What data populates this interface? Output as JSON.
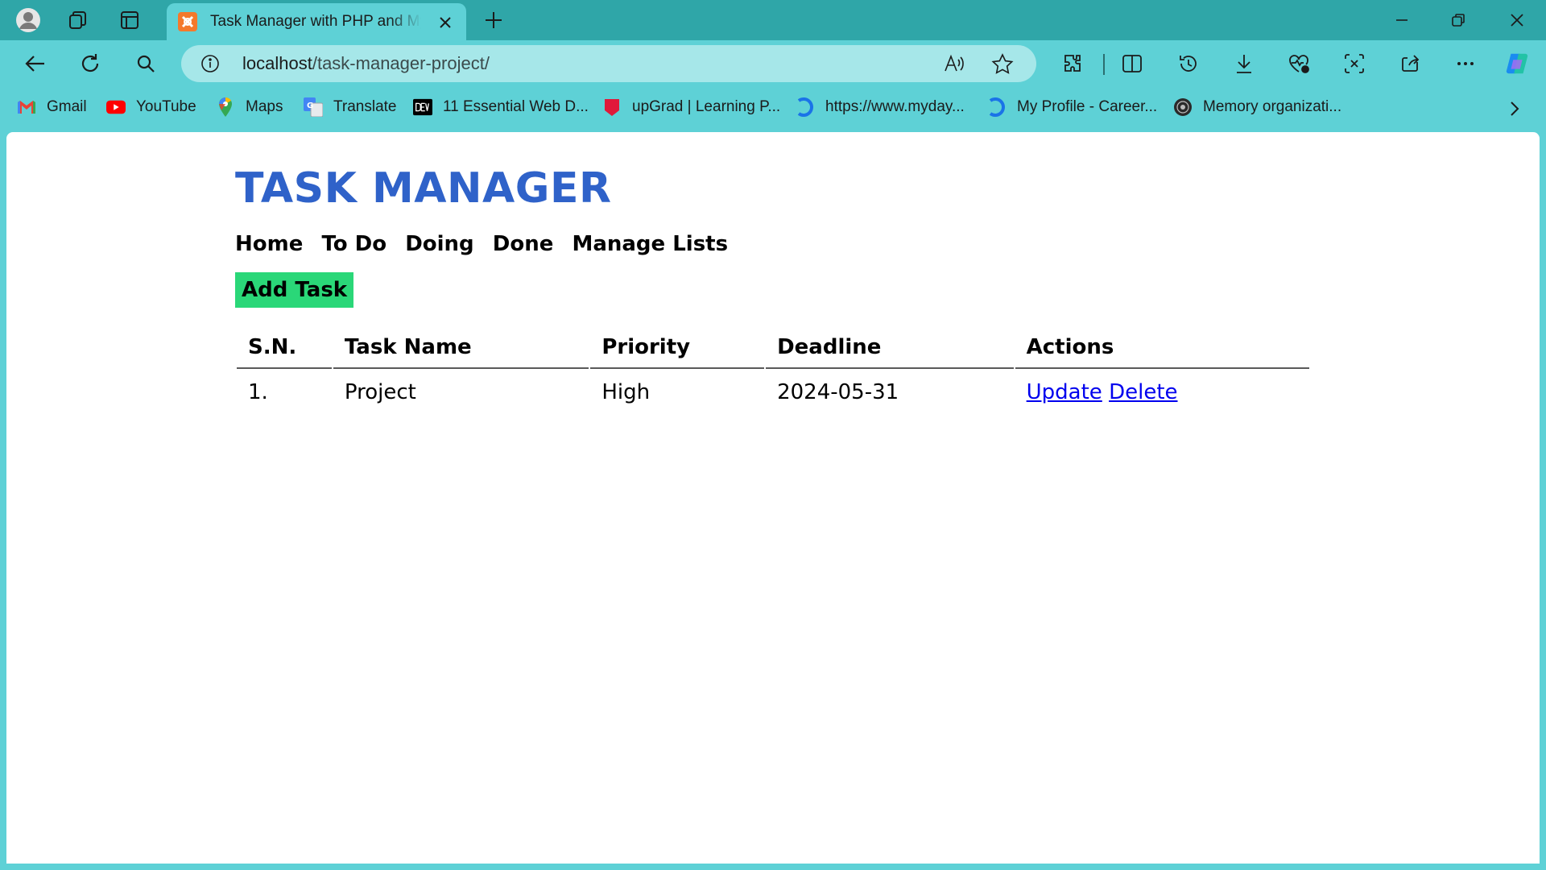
{
  "browser": {
    "tab_title": "Task Manager with PHP and MySQL",
    "url_host": "localhost",
    "url_path": "/task-manager-project/",
    "icons": {
      "profile": "profile-avatar-icon",
      "workspaces": "workspaces-icon",
      "tab_actions": "tab-actions-icon",
      "favicon": "xampp-favicon",
      "back": "back-arrow-icon",
      "refresh": "refresh-icon",
      "search": "search-icon",
      "info": "info-icon",
      "read_aloud": "read-aloud-icon",
      "favorite": "star-icon",
      "extensions": "extensions-icon",
      "split_screen": "split-screen-icon",
      "history": "history-icon",
      "downloads": "download-icon",
      "health": "browser-essentials-icon",
      "screenshot": "screenshot-icon",
      "share": "share-icon",
      "more": "more-icon",
      "copilot": "copilot-icon"
    },
    "bookmarks": [
      {
        "label": "Gmail",
        "icon": "gmail-icon"
      },
      {
        "label": "YouTube",
        "icon": "youtube-icon"
      },
      {
        "label": "Maps",
        "icon": "maps-icon"
      },
      {
        "label": "Translate",
        "icon": "translate-icon"
      },
      {
        "label": "11 Essential Web D...",
        "icon": "dev-icon"
      },
      {
        "label": "upGrad | Learning P...",
        "icon": "upgrad-icon"
      },
      {
        "label": "https://www.myday...",
        "icon": "myday-icon"
      },
      {
        "label": "My Profile - Career...",
        "icon": "career-icon"
      },
      {
        "label": "Memory organizati...",
        "icon": "memory-icon"
      }
    ]
  },
  "app": {
    "title": "TASK MANAGER",
    "menu": [
      "Home",
      "To Do",
      "Doing",
      "Done",
      "Manage Lists"
    ],
    "add_task_label": "Add Task",
    "table": {
      "headers": [
        "S.N.",
        "Task Name",
        "Priority",
        "Deadline",
        "Actions"
      ],
      "rows": [
        {
          "sn": "1.",
          "task_name": "Project",
          "priority": "High",
          "deadline": "2024-05-31",
          "update_label": "Update",
          "delete_label": "Delete"
        }
      ]
    },
    "colors": {
      "title": "#2f62c9",
      "add_button": "#2ad778",
      "link": "#0000ee",
      "browser_frame": "#5ed1d6"
    }
  }
}
